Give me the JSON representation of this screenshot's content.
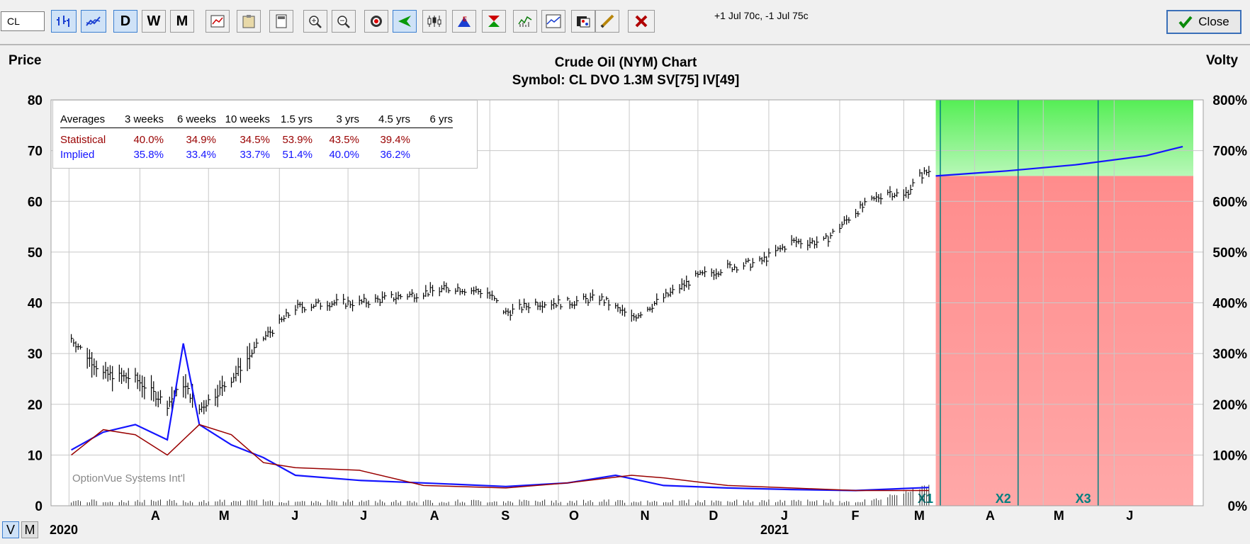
{
  "toolbar": {
    "symbol": "CL",
    "period_buttons": [
      "D",
      "W",
      "M"
    ],
    "strategy_text": "+1 Jul 70c, -1 Jul 75c",
    "close_label": "Close"
  },
  "colors": {
    "price_bars": "#000000",
    "implied_line": "#1414ff",
    "statistical_line": "#990000",
    "profit_zone": "#7ff57f",
    "loss_zone": "#ffa8a8",
    "expiry_marker": "#008080"
  },
  "icons": [
    "bar-chart-icon",
    "line-chart-icon",
    "overlay-icon",
    "clipboard-icon",
    "calculator-icon",
    "zoom-in-icon",
    "zoom-out-icon",
    "target-icon",
    "arrow-left-icon",
    "candlestick-icon",
    "earnings-icon",
    "hourglass-icon",
    "volume-chart-icon",
    "volatility-chart-icon",
    "palette-icon",
    "pencil-icon",
    "delete-icon",
    "checkmark-icon"
  ],
  "watermark": "OptionVue Systems Int'l",
  "bottom_buttons": [
    "V",
    "M"
  ],
  "averages": {
    "header_label": "Averages",
    "periods": [
      "3 weeks",
      "6 weeks",
      "10 weeks",
      "1.5 yrs",
      "3 yrs",
      "4.5 yrs",
      "6 yrs"
    ],
    "statistical_label": "Statistical",
    "statistical": [
      "40.0%",
      "34.9%",
      "34.5%",
      "53.9%",
      "43.5%",
      "39.4%",
      ""
    ],
    "implied_label": "Implied",
    "implied": [
      "35.8%",
      "33.4%",
      "33.7%",
      "51.4%",
      "40.0%",
      "36.2%",
      ""
    ]
  },
  "chart_data": {
    "type": "bar",
    "title": "Crude Oil (NYM) Chart",
    "subtitle": "Symbol: CL  DVO 1.3M  SV[75]  IV[49]",
    "ylabel_left": "Price",
    "ylabel_right": "Volty",
    "ylim_left": [
      0,
      80
    ],
    "ylim_right": [
      0,
      800
    ],
    "yticks_left": [
      "0",
      "10",
      "20",
      "30",
      "40",
      "50",
      "60",
      "70",
      "80"
    ],
    "yticks_right": [
      "0%",
      "100%",
      "200%",
      "300%",
      "400%",
      "500%",
      "600%",
      "700%",
      "800%"
    ],
    "month_labels": [
      "A",
      "M",
      "J",
      "J",
      "A",
      "S",
      "O",
      "N",
      "D",
      "J",
      "F",
      "M",
      "A",
      "M",
      "J"
    ],
    "year_labels": [
      "2020",
      "2021"
    ],
    "grid": true,
    "price_series": {
      "name": "CL",
      "x": [
        "2020-03-02",
        "2020-03-16",
        "2020-03-30",
        "2020-04-13",
        "2020-04-20",
        "2020-04-27",
        "2020-05-11",
        "2020-05-25",
        "2020-06-08",
        "2020-06-22",
        "2020-07-06",
        "2020-07-20",
        "2020-08-03",
        "2020-08-17",
        "2020-08-31",
        "2020-09-08",
        "2020-09-21",
        "2020-10-05",
        "2020-10-19",
        "2020-11-02",
        "2020-11-16",
        "2020-11-30",
        "2020-12-14",
        "2020-12-28",
        "2021-01-11",
        "2021-01-25",
        "2021-02-08",
        "2021-02-22",
        "2021-03-01",
        "2021-03-08",
        "2021-03-12"
      ],
      "close": [
        33,
        26,
        25,
        20,
        24,
        19,
        25,
        33,
        39,
        40,
        40,
        41,
        42,
        43,
        42,
        38,
        40,
        40,
        41,
        37,
        41,
        45,
        47,
        48,
        52,
        52,
        58,
        62,
        61,
        65,
        66
      ]
    },
    "volatility_series": [
      {
        "name": "Implied",
        "x": [
          "2020-03-02",
          "2020-03-16",
          "2020-03-30",
          "2020-04-13",
          "2020-04-20",
          "2020-04-27",
          "2020-05-11",
          "2020-05-25",
          "2020-06-08",
          "2020-07-06",
          "2020-08-03",
          "2020-09-08",
          "2020-10-05",
          "2020-10-26",
          "2020-11-16",
          "2020-12-14",
          "2021-01-11",
          "2021-02-08",
          "2021-03-12"
        ],
        "y": [
          110,
          145,
          160,
          130,
          320,
          160,
          120,
          95,
          60,
          50,
          45,
          38,
          45,
          60,
          40,
          35,
          32,
          30,
          36
        ]
      },
      {
        "name": "Statistical",
        "x": [
          "2020-03-02",
          "2020-03-16",
          "2020-03-30",
          "2020-04-13",
          "2020-04-27",
          "2020-05-11",
          "2020-05-25",
          "2020-06-08",
          "2020-07-06",
          "2020-08-03",
          "2020-09-08",
          "2020-10-05",
          "2020-11-02",
          "2020-11-16",
          "2020-12-14",
          "2021-01-11",
          "2021-02-08",
          "2021-03-12"
        ],
        "y": [
          100,
          150,
          140,
          100,
          160,
          140,
          85,
          75,
          70,
          40,
          35,
          45,
          60,
          55,
          40,
          35,
          30,
          30
        ]
      },
      {
        "name": "Projected IV",
        "x": [
          "2021-03-15",
          "2021-04-15",
          "2021-05-15",
          "2021-06-15",
          "2021-07-01"
        ],
        "y": [
          650,
          660,
          672,
          690,
          708
        ]
      }
    ],
    "expiry_markers": [
      "X1",
      "X2",
      "X3"
    ],
    "projection_start": "2021-03-15",
    "profit_zone_above_pct": 650
  }
}
